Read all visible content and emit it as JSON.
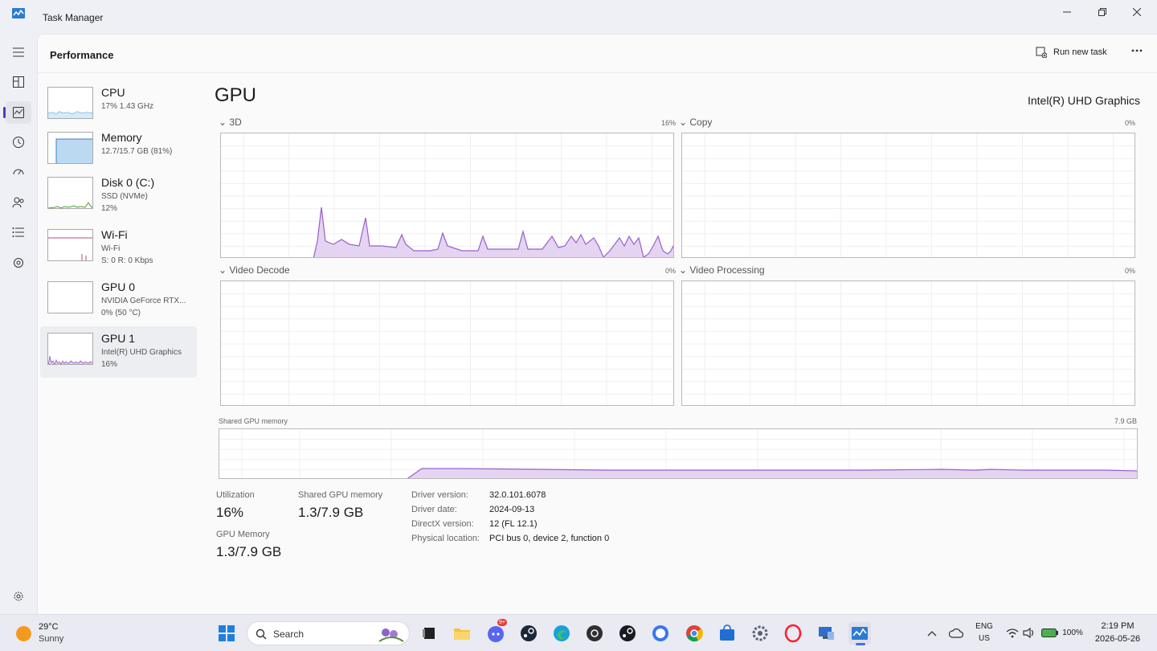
{
  "window": {
    "title": "Task Manager"
  },
  "header": {
    "title": "Performance",
    "run_new_task": "Run new task"
  },
  "sidebar": [
    {
      "name": "CPU",
      "line1": "17%  1.43 GHz",
      "line2": ""
    },
    {
      "name": "Memory",
      "line1": "12.7/15.7 GB (81%)",
      "line2": ""
    },
    {
      "name": "Disk 0 (C:)",
      "line1": "SSD (NVMe)",
      "line2": "12%"
    },
    {
      "name": "Wi-Fi",
      "line1": "Wi-Fi",
      "line2": "S: 0 R: 0 Kbps"
    },
    {
      "name": "GPU 0",
      "line1": "NVIDIA GeForce RTX...",
      "line2": "0%  (50 °C)"
    },
    {
      "name": "GPU 1",
      "line1": "Intel(R) UHD Graphics",
      "line2": "16%"
    }
  ],
  "gpu": {
    "title": "GPU",
    "adapter": "Intel(R) UHD Graphics",
    "engines": [
      {
        "label": "3D",
        "pct": "16%"
      },
      {
        "label": "Copy",
        "pct": "0%"
      },
      {
        "label": "Video Decode",
        "pct": "0%"
      },
      {
        "label": "Video Processing",
        "pct": "0%"
      }
    ],
    "shared_label": "Shared GPU memory",
    "shared_max": "7.9 GB",
    "stats": {
      "utilization_label": "Utilization",
      "utilization": "16%",
      "shared_label": "Shared GPU memory",
      "shared": "1.3/7.9 GB",
      "gpu_mem_label": "GPU Memory",
      "gpu_mem": "1.3/7.9 GB"
    },
    "props": [
      {
        "label": "Driver version:",
        "value": "32.0.101.6078"
      },
      {
        "label": "Driver date:",
        "value": "2024-09-13"
      },
      {
        "label": "DirectX version:",
        "value": "12 (FL 12.1)"
      },
      {
        "label": "Physical location:",
        "value": "PCI bus 0, device 2, function 0"
      }
    ]
  },
  "taskbar": {
    "weather_temp": "29°C",
    "weather_desc": "Sunny",
    "search": "Search",
    "lang1": "ENG",
    "lang2": "US",
    "battery": "100%",
    "time": "2:19 PM",
    "date": "2026-05-26",
    "badge": "9+"
  },
  "colors": {
    "accent": "#9a5fc8",
    "fill": "#dcc8ef",
    "cpu": "#3a9ad9",
    "disk": "#4e9a2e",
    "wifi": "#b04a80"
  }
}
